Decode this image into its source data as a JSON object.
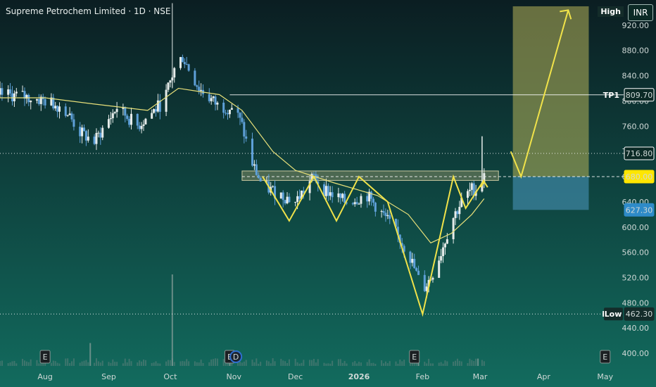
{
  "header": {
    "symbol_title": "Supreme Petrochem Limited · 1D · NSE",
    "currency": "INR",
    "high_label": "High",
    "low_label": "Low",
    "tp1_label": "TP1",
    "event_label": "E",
    "dividend_label": "D"
  },
  "colors": {
    "bg_top": "#0b1e22",
    "bg_bottom": "#126b5e",
    "candle_up": "#e6ecea",
    "candle_down": "#5ea0d8",
    "ma_line": "#e8e07a",
    "pattern": "#f0e24a",
    "level": "#ffffff",
    "zone": "#9a9a6a",
    "target_box": "#b7b25a",
    "stop_box": "#3a7f9a",
    "tag_yellow": "#ffe600",
    "tag_blue": "#2e8bc8"
  },
  "chart_data": {
    "type": "candlestick",
    "title": "Supreme Petrochem Limited · 1D · NSE",
    "ylim": [
      380,
      960
    ],
    "y_ticks": [
      "400.00",
      "440.00",
      "480.00",
      "520.00",
      "560.00",
      "600.00",
      "640.00",
      "680.00",
      "720.00",
      "760.00",
      "800.00",
      "840.00",
      "880.00",
      "920.00"
    ],
    "x_ticks": [
      {
        "label": "Aug",
        "date": "2025-08-01"
      },
      {
        "label": "Sep",
        "date": "2025-09-01"
      },
      {
        "label": "Oct",
        "date": "2025-10-01"
      },
      {
        "label": "Nov",
        "date": "2025-11-01"
      },
      {
        "label": "Dec",
        "date": "2025-12-01"
      },
      {
        "label": "2026",
        "date": "2026-01-01"
      },
      {
        "label": "Feb",
        "date": "2026-02-01"
      },
      {
        "label": "Mar",
        "date": "2026-03-01"
      },
      {
        "label": "Apr",
        "date": "2026-04-01"
      },
      {
        "label": "May",
        "date": "2026-05-01"
      }
    ],
    "date_range": [
      "2025-07-10",
      "2026-05-10"
    ],
    "close_path": [
      [
        "2025-07-10",
        810
      ],
      [
        "2025-07-20",
        808
      ],
      [
        "2025-08-01",
        800
      ],
      [
        "2025-08-10",
        790
      ],
      [
        "2025-08-18",
        750
      ],
      [
        "2025-08-25",
        735
      ],
      [
        "2025-09-05",
        790
      ],
      [
        "2025-09-15",
        760
      ],
      [
        "2025-09-20",
        775
      ],
      [
        "2025-09-28",
        800
      ],
      [
        "2025-10-03",
        850
      ],
      [
        "2025-10-07",
        870
      ],
      [
        "2025-10-15",
        820
      ],
      [
        "2025-10-25",
        790
      ],
      [
        "2025-11-01",
        790
      ],
      [
        "2025-11-05",
        760
      ],
      [
        "2025-11-10",
        700
      ],
      [
        "2025-11-15",
        665
      ],
      [
        "2025-11-25",
        650
      ],
      [
        "2025-12-01",
        640
      ],
      [
        "2025-12-10",
        680
      ],
      [
        "2025-12-15",
        660
      ],
      [
        "2025-12-25",
        640
      ],
      [
        "2026-01-05",
        650
      ],
      [
        "2026-01-15",
        610
      ],
      [
        "2026-01-25",
        560
      ],
      [
        "2026-02-01",
        500
      ],
      [
        "2026-02-05",
        520
      ],
      [
        "2026-02-10",
        560
      ],
      [
        "2026-02-15",
        610
      ],
      [
        "2026-02-20",
        640
      ],
      [
        "2026-02-25",
        660
      ],
      [
        "2026-03-01",
        660
      ],
      [
        "2026-03-03",
        690
      ]
    ],
    "volume_spikes": [
      {
        "date": "2025-08-23",
        "rel": 0.25
      },
      {
        "date": "2025-10-02",
        "rel": 1.0
      },
      {
        "date": "2025-10-30",
        "rel": 0.15
      },
      {
        "date": "2026-01-30",
        "rel": 0.12
      },
      {
        "date": "2026-02-28",
        "rel": 0.08
      }
    ],
    "ma_path": [
      [
        "2025-07-10",
        805
      ],
      [
        "2025-08-01",
        805
      ],
      [
        "2025-08-25",
        795
      ],
      [
        "2025-09-20",
        785
      ],
      [
        "2025-10-05",
        820
      ],
      [
        "2025-10-25",
        810
      ],
      [
        "2025-11-05",
        785
      ],
      [
        "2025-11-20",
        720
      ],
      [
        "2025-12-01",
        690
      ],
      [
        "2025-12-20",
        670
      ],
      [
        "2026-01-10",
        650
      ],
      [
        "2026-01-25",
        620
      ],
      [
        "2026-02-05",
        575
      ],
      [
        "2026-02-15",
        590
      ],
      [
        "2026-02-25",
        620
      ],
      [
        "2026-03-03",
        645
      ]
    ],
    "pattern_path": [
      [
        "2025-11-15",
        680
      ],
      [
        "2025-11-28",
        610
      ],
      [
        "2025-12-10",
        680
      ],
      [
        "2025-12-21",
        610
      ],
      [
        "2026-01-01",
        680
      ],
      [
        "2026-01-15",
        640
      ],
      [
        "2026-02-01",
        462
      ],
      [
        "2026-02-16",
        680
      ],
      [
        "2026-02-22",
        630
      ],
      [
        "2026-03-03",
        675
      ]
    ],
    "arrow_path": [
      [
        "2026-03-16",
        720
      ],
      [
        "2026-03-21",
        680
      ],
      [
        "2026-04-13",
        944
      ]
    ],
    "levels": [
      {
        "name": "TP1",
        "value": 809.7,
        "label": "809.70",
        "from": "2025-10-30"
      },
      {
        "name": "",
        "value": 716.8,
        "label": "716.80",
        "from": "2025-07-10"
      },
      {
        "name": "",
        "value": 680.0,
        "label": "680.00",
        "from": "2025-11-05"
      },
      {
        "name": "Low",
        "value": 462.3,
        "label": "462.30",
        "from": "2025-07-10"
      }
    ],
    "zone": {
      "from": "2025-11-05",
      "to": "2026-03-10",
      "low": 674,
      "high": 689
    },
    "target_box": {
      "from": "2026-03-17",
      "to": "2026-04-23",
      "low": 680,
      "high": 950
    },
    "stop_box": {
      "from": "2026-03-17",
      "to": "2026-04-23",
      "low": 627.3,
      "high": 680
    },
    "price_tags": [
      {
        "value": 627.3,
        "label": "627.30",
        "style": "blue"
      },
      {
        "value": 680.0,
        "label": "680.00",
        "style": "yellow"
      },
      {
        "value": 716.8,
        "label": "716.80",
        "style": "white"
      },
      {
        "value": 809.7,
        "label": "809.70",
        "style": "white"
      },
      {
        "value": 462.3,
        "label": "462.30",
        "style": "dark"
      }
    ],
    "events": [
      {
        "type": "E",
        "date": "2025-08-01"
      },
      {
        "type": "E",
        "date": "2025-10-30"
      },
      {
        "type": "D",
        "date": "2025-11-02"
      },
      {
        "type": "E",
        "date": "2026-01-28"
      },
      {
        "type": "E",
        "date": "2026-05-01"
      }
    ]
  }
}
